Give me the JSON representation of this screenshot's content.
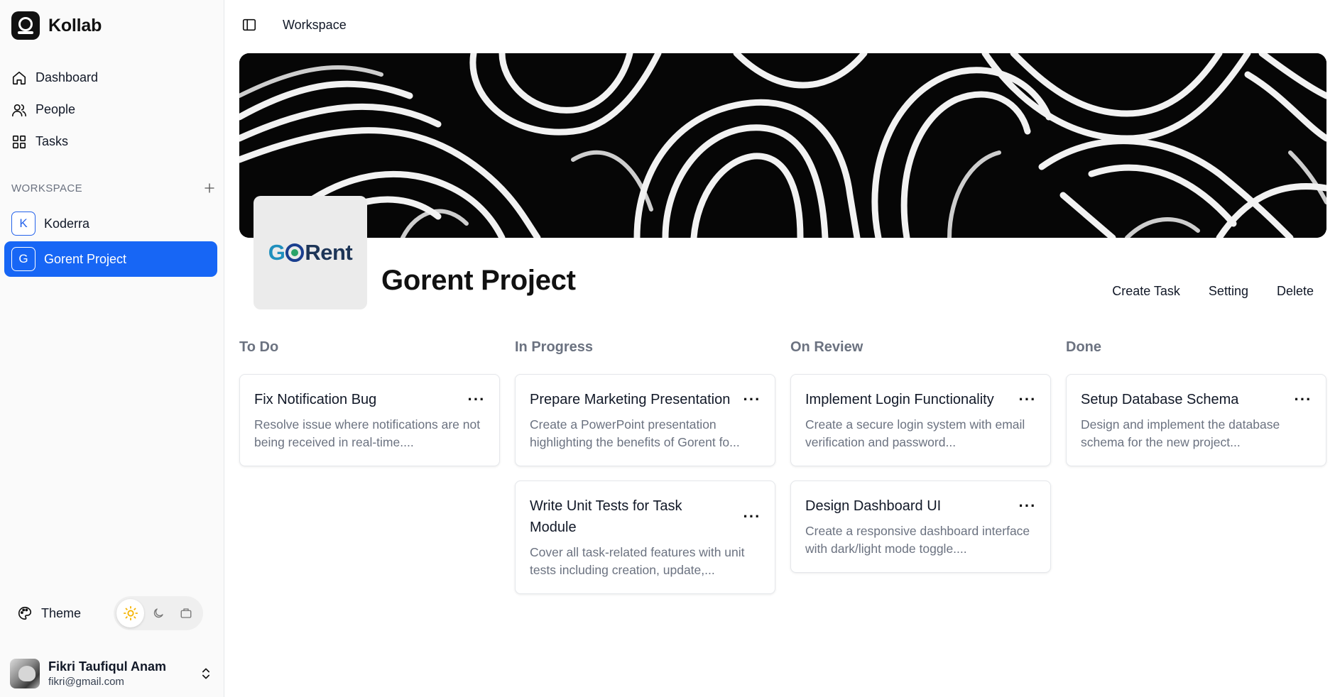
{
  "app": {
    "name": "Kollab"
  },
  "nav": [
    {
      "label": "Dashboard",
      "icon": "home-icon"
    },
    {
      "label": "People",
      "icon": "users-icon"
    },
    {
      "label": "Tasks",
      "icon": "grid-icon"
    }
  ],
  "workspace_section": {
    "title": "WORKSPACE"
  },
  "workspaces": [
    {
      "initial": "K",
      "name": "Koderra",
      "active": false
    },
    {
      "initial": "G",
      "name": "Gorent Project",
      "active": true
    }
  ],
  "theme": {
    "label": "Theme",
    "options": [
      "light",
      "dark",
      "system"
    ],
    "selected": "light"
  },
  "user": {
    "name": "Fikri Taufiqul Anam",
    "email": "fikri@gmail.com"
  },
  "breadcrumb": "Workspace",
  "project": {
    "title": "Gorent Project",
    "logo": {
      "part1": "G",
      "part2": "Rent"
    },
    "actions": {
      "create": "Create Task",
      "setting": "Setting",
      "delete": "Delete"
    }
  },
  "board": [
    {
      "title": "To Do",
      "cards": [
        {
          "title": "Fix Notification Bug",
          "desc": "Resolve issue where notifications are not being received in real-time...."
        }
      ]
    },
    {
      "title": "In Progress",
      "cards": [
        {
          "title": "Prepare Marketing Presentation",
          "desc": "Create a PowerPoint presentation highlighting the benefits of Gorent fo..."
        },
        {
          "title": "Write Unit Tests for Task Module",
          "desc": "Cover all task-related features with unit tests including creation, update,..."
        }
      ]
    },
    {
      "title": "On Review",
      "cards": [
        {
          "title": "Implement Login Functionality",
          "desc": "Create a secure login system with email verification and password..."
        },
        {
          "title": "Design Dashboard UI",
          "desc": "Create a responsive dashboard interface with dark/light mode toggle...."
        }
      ]
    },
    {
      "title": "Done",
      "cards": [
        {
          "title": "Setup Database Schema",
          "desc": "Design and implement the database schema for the new project..."
        }
      ]
    }
  ],
  "colors": {
    "accent": "#1766f5",
    "muted": "#6b7280",
    "sun": "#f5b301"
  }
}
